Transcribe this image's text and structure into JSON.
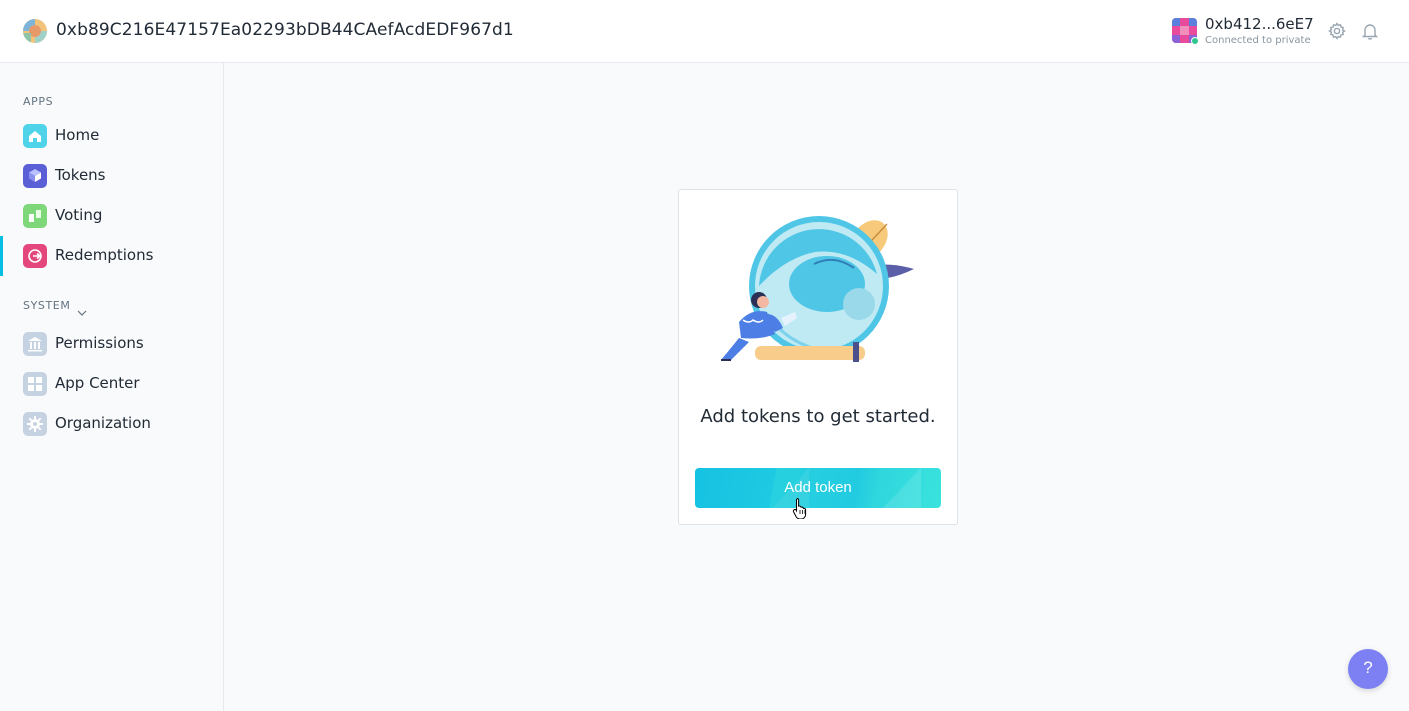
{
  "header": {
    "org_address": "0xb89C216E47157Ea02293bDB44CAefAcdEDF967d1",
    "account_address": "0xb412...6eE7",
    "account_network": "Connected to private"
  },
  "sidebar": {
    "apps_label": "APPS",
    "system_label": "SYSTEM",
    "apps": [
      {
        "label": "Home",
        "icon": "home-icon"
      },
      {
        "label": "Tokens",
        "icon": "tokens-icon"
      },
      {
        "label": "Voting",
        "icon": "voting-icon"
      },
      {
        "label": "Redemptions",
        "icon": "redemptions-icon",
        "active": true
      }
    ],
    "system": [
      {
        "label": "Permissions",
        "icon": "permissions-icon"
      },
      {
        "label": "App Center",
        "icon": "app-center-icon"
      },
      {
        "label": "Organization",
        "icon": "organization-icon"
      }
    ]
  },
  "main": {
    "empty_message": "Add tokens to get started.",
    "add_button_label": "Add token"
  },
  "help": {
    "label": "?"
  },
  "colors": {
    "accent": "#08bee5",
    "help_button": "#7c80f2",
    "status_connected": "#2cc68f"
  }
}
